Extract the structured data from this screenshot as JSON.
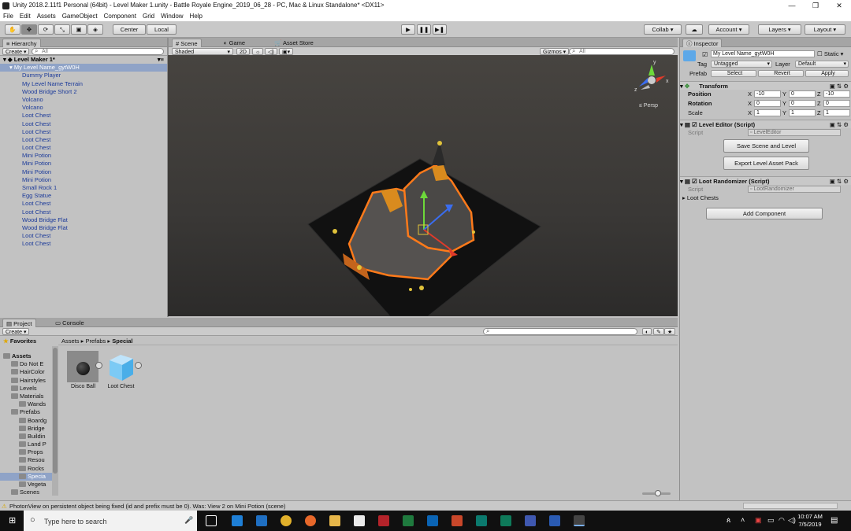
{
  "window": {
    "title": "Unity 2018.2.11f1 Personal (64bit) - Level Maker 1.unity - Battle Royale Engine_2019_06_28 - PC, Mac & Linux Standalone* <DX11>",
    "controls": [
      "—",
      "❐",
      "✕"
    ]
  },
  "menu": [
    "File",
    "Edit",
    "Assets",
    "GameObject",
    "Component",
    "Grid",
    "Window",
    "Help"
  ],
  "toolbar": {
    "pivot": "Center",
    "space": "Local",
    "collab": "Collab ▾",
    "account": "Account",
    "layers": "Layers",
    "layout": "Layout"
  },
  "hierarchy": {
    "tab": "Hierarchy",
    "create": "Create ▾",
    "search_placeholder": "All",
    "scene_name": "Level Maker 1*",
    "selected": "My Level Name_gytW0H",
    "items": [
      "Dummy Player",
      "My Level Name Terrain",
      "Wood Bridge Short 2",
      "Volcano",
      "Volcano",
      "Loot Chest",
      "Loot Chest",
      "Loot Chest",
      "Loot Chest",
      "Loot Chest",
      "Mini Potion",
      "Mini Potion",
      "Mini Potion",
      "Mini Potion",
      "Small Rock 1",
      "Egg Statue",
      "Loot Chest",
      "Loot Chest",
      "Wood Bridge Flat",
      "Wood Bridge Flat",
      "Loot Chest",
      "Loot Chest"
    ]
  },
  "scene": {
    "tabs": [
      "Scene",
      "Game",
      "Asset Store"
    ],
    "shading": "Shaded",
    "mode2d": "2D",
    "gizmos": "Gizmos ▾",
    "search_placeholder": "All",
    "persp": "≤ Persp",
    "axes": {
      "y": "y",
      "x": "x",
      "z": "z"
    }
  },
  "inspector": {
    "tab": "Inspector",
    "object_name": "My Level Name_gytW0H",
    "static_label": "Static ▾",
    "tag_label": "Tag",
    "tag_value": "Untagged",
    "layer_label": "Layer",
    "layer_value": "Default",
    "prefab_label": "Prefab",
    "prefab_select": "Select",
    "prefab_revert": "Revert",
    "prefab_apply": "Apply",
    "transform": {
      "title": "Transform",
      "position_label": "Position",
      "rotation_label": "Rotation",
      "scale_label": "Scale",
      "position": [
        "-10",
        "0",
        "-10"
      ],
      "rotation": [
        "0",
        "0",
        "0"
      ],
      "scale": [
        "1",
        "1",
        "1"
      ]
    },
    "level_editor": {
      "title": "Level Editor (Script)",
      "script_label": "Script",
      "script_value": "LevelEditor",
      "save_button": "Save Scene and Level",
      "export_button": "Export Level Asset Pack"
    },
    "loot_randomizer": {
      "title": "Loot Randomizer (Script)",
      "script_label": "Script",
      "script_value": "LootRandomizer",
      "loot_chests": "Loot Chests"
    },
    "add_component": "Add Component"
  },
  "project": {
    "tabs": [
      "Project",
      "Console"
    ],
    "create": "Create ▾",
    "favorites": "Favorites",
    "breadcrumb": [
      "Assets",
      "Prefabs",
      "Special"
    ],
    "tree": [
      {
        "label": "Assets",
        "bold": true,
        "indent": 0
      },
      {
        "label": "Do Not E",
        "indent": 1
      },
      {
        "label": "HairColor",
        "indent": 1
      },
      {
        "label": "Hairstyles",
        "indent": 1
      },
      {
        "label": "Levels",
        "indent": 1
      },
      {
        "label": "Materials",
        "indent": 1
      },
      {
        "label": "Wands",
        "indent": 2
      },
      {
        "label": "Prefabs",
        "indent": 1
      },
      {
        "label": "Boardg",
        "indent": 2
      },
      {
        "label": "Bridge",
        "indent": 2
      },
      {
        "label": "Buildin",
        "indent": 2
      },
      {
        "label": "Land P",
        "indent": 2
      },
      {
        "label": "Props",
        "indent": 2
      },
      {
        "label": "Resou",
        "indent": 2
      },
      {
        "label": "Rocks",
        "indent": 2
      },
      {
        "label": "Specia",
        "indent": 2,
        "selected": true
      },
      {
        "label": "Vegeta",
        "indent": 2
      },
      {
        "label": "Scenes",
        "indent": 1
      }
    ],
    "assets": [
      {
        "label": "Disco Ball",
        "kind": "disco"
      },
      {
        "label": "Loot Chest",
        "kind": "cube"
      }
    ]
  },
  "status": {
    "message": "PhotonView on persistent object being fixed (id and prefix must be 0). Was: View 2 on Mini Potion (scene)"
  },
  "taskbar": {
    "search_placeholder": "Type here to search",
    "time": "10:07 AM",
    "date": "7/5/2019"
  }
}
